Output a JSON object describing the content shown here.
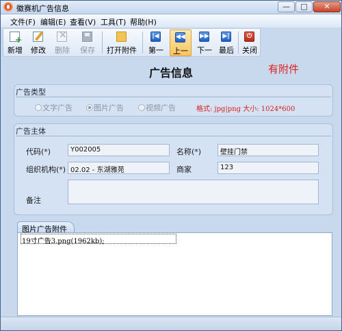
{
  "window": {
    "title": "徽赛机广告信息",
    "buttons": {
      "minimize": "—",
      "maximize": "□",
      "close": "✕"
    }
  },
  "menu": [
    {
      "label": "文件(F)"
    },
    {
      "label": "编辑(E)"
    },
    {
      "label": "查看(V)"
    },
    {
      "label": "工具(T)"
    },
    {
      "label": "帮助(H)"
    }
  ],
  "toolbar": {
    "new": "新增",
    "modify": "修改",
    "delete": "删除",
    "save": "保存",
    "open_attachment": "打开附件",
    "first": "第一",
    "previous": "上一",
    "next": "下一",
    "last": "最后",
    "close": "关闭",
    "icon_first": "|◀",
    "icon_previous": "◀◀",
    "icon_next": "▶▶",
    "icon_last": "▶|",
    "icon_close": "⏻"
  },
  "page": {
    "title": "广告信息",
    "attachment_flag": "有附件",
    "accent_color": "#e01f1f"
  },
  "ad_type": {
    "title": "广告类型",
    "options": [
      "文字广告",
      "图片广告",
      "视频广告"
    ],
    "selected": "图片广告",
    "format_hint": "格式: jpg|png  大小: 1024*600"
  },
  "ad_subject": {
    "title": "广告主体",
    "code_label": "代码(*)",
    "code_value": "Y002005",
    "name_label": "名称(*)",
    "name_value": "壁挂门禁",
    "org_label": "组织机构(*)",
    "org_value": "02.02 - 东湖雅苑",
    "vendor_label": "商家",
    "vendor_value": "123",
    "remark_label": "备注",
    "remark_value": ""
  },
  "attachment": {
    "tab_label": "图片广告附件",
    "files": [
      "19寸广告3.png(1962kb);"
    ]
  }
}
